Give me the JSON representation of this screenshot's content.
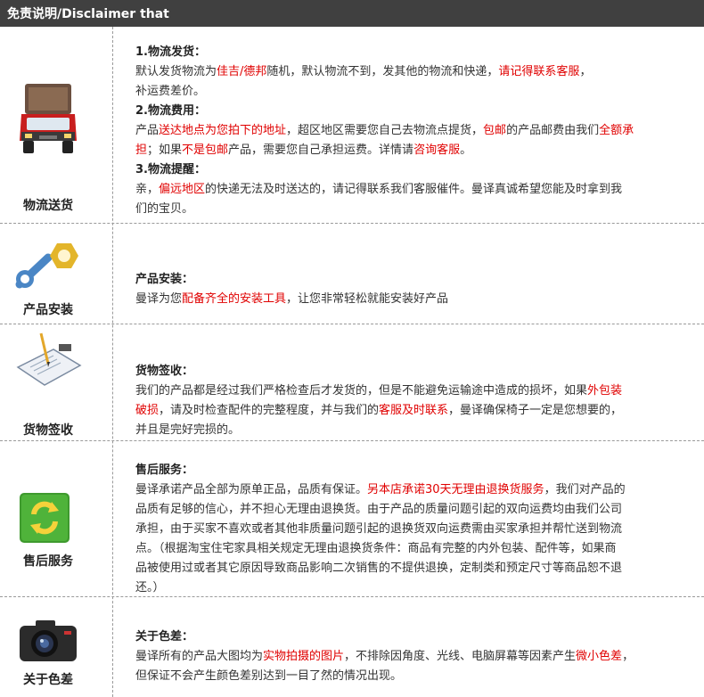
{
  "header": {
    "title": "免责说明/Disclaimer that"
  },
  "sections": {
    "logistics": {
      "label": "物流送货",
      "icon": "delivery-truck-icon",
      "items": [
        {
          "title": "1.物流发货：",
          "parts": [
            "默认发货物流为",
            "佳吉/德邦",
            "随机，默认物流不到，发其他的物流和快递，",
            "请记得联系客服",
            "，"
          ],
          "line2": "补运费差价。"
        },
        {
          "title": "2.物流费用：",
          "parts": [
            "产品",
            "送达地点为您拍下的地址",
            "，超区地区需要您自己去物流点提货，",
            "包邮",
            "的产品邮费由我们",
            "全额承"
          ],
          "parts2": [
            "担",
            "；如果",
            "不是包邮",
            "产品，需要您自己承担运费。详情请",
            "咨询客服",
            "。"
          ]
        },
        {
          "title": "3.物流提醒：",
          "parts": [
            "亲，",
            "偏远地区",
            "的快递无法及时送达的，请记得联系我们客服催件。曼译真诚希望您能及时拿到我"
          ],
          "line2": "们的宝贝。"
        }
      ]
    },
    "install": {
      "label": "产品安装",
      "icon": "wrench-nut-icon",
      "title": "产品安装：",
      "parts": [
        "曼译为您",
        "配备齐全的安装工具",
        "，让您非常轻松就能安装好产品"
      ]
    },
    "receipt": {
      "label": "货物签收",
      "icon": "signing-document-icon",
      "title": "货物签收：",
      "parts": [
        "我们的产品都是经过我们严格检查后才发货的，但是不能避免运输途中造成的损坏，如果",
        "外包装"
      ],
      "parts2": [
        "破损",
        "，请及时检查配件的完整程度，并与我们的",
        "客服及时联系",
        "，曼译确保椅子一定是您想要的，"
      ],
      "line3": "并且是完好完损的。"
    },
    "aftersale": {
      "label": "售后服务",
      "icon": "refresh-arrows-icon",
      "title": "售后服务：",
      "parts": [
        "曼译承诺产品全部为原单正品，品质有保证。",
        "另本店承诺30天无理由退换货服务",
        "，我们对产品的"
      ],
      "lines": [
        "品质有足够的信心，并不担心无理由退换货。由于产品的质量问题引起的双向运费均由我们公司",
        "承担，由于买家不喜欢或者其他非质量问题引起的退换货双向运费需由买家承担并帮忙送到物流",
        "点。（根据淘宝住宅家具相关规定无理由退换货条件：商品有完整的内外包装、配件等，如果商",
        "品被使用过或者其它原因导致商品影响二次销售的不提供退换，定制类和预定尺寸等商品恕不退",
        "还。）"
      ]
    },
    "color": {
      "label": "关于色差",
      "icon": "camera-icon",
      "title": "关于色差：",
      "parts": [
        "曼译所有的产品大图均为",
        "实物拍摄的图片",
        "，不排除因角度、光线、电脑屏幕等因素产生",
        "微小色差",
        "，"
      ],
      "line2": "但保证不会产生颜色差别达到一目了然的情况出现。"
    }
  },
  "colors": {
    "header_bg": "#404040",
    "highlight": "#e00000",
    "divider": "#9a9a9a"
  }
}
